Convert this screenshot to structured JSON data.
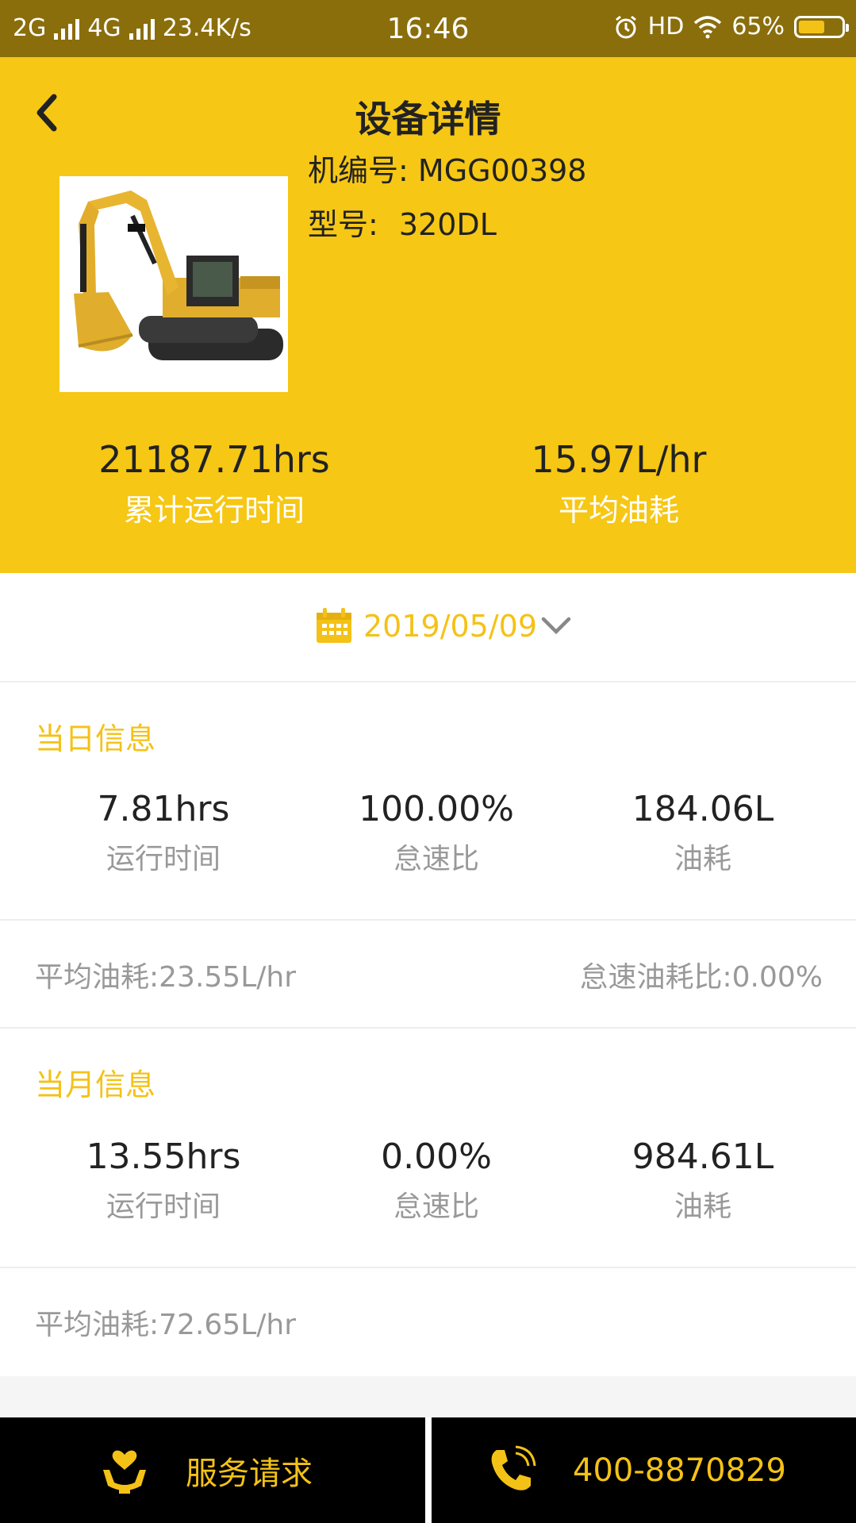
{
  "status_bar": {
    "network1": "2G",
    "network2": "4G",
    "speed": "23.4K/s",
    "time": "16:46",
    "hd": "HD",
    "battery": "65%",
    "battery_level": 0.65
  },
  "header": {
    "title": "设备详情",
    "machine_no_label": "机编号:",
    "machine_no": "MGG00398",
    "model_label": "型号:",
    "model": "320DL",
    "total_runtime_value": "21187.71hrs",
    "total_runtime_label": "累计运行时间",
    "avg_fuel_value": "15.97L/hr",
    "avg_fuel_label": "平均油耗"
  },
  "date_selector": {
    "date": "2019/05/09"
  },
  "daily": {
    "title": "当日信息",
    "runtime_value": "7.81hrs",
    "runtime_label": "运行时间",
    "idle_value": "100.00%",
    "idle_label": "怠速比",
    "fuel_value": "184.06L",
    "fuel_label": "油耗",
    "avg_fuel_label": "平均油耗:",
    "avg_fuel_value": "23.55L/hr",
    "idle_fuel_label": "怠速油耗比:",
    "idle_fuel_value": "0.00%"
  },
  "monthly": {
    "title": "当月信息",
    "runtime_value": "13.55hrs",
    "runtime_label": "运行时间",
    "idle_value": "0.00%",
    "idle_label": "怠速比",
    "fuel_value": "984.61L",
    "fuel_label": "油耗",
    "avg_fuel_label": "平均油耗:",
    "avg_fuel_value": "72.65L/hr"
  },
  "bottom_bar": {
    "service_label": "服务请求",
    "phone": "400-8870829"
  },
  "colors": {
    "accent": "#f6c714",
    "accent_text": "#f4c216",
    "status_bar": "#8a6e0c"
  },
  "icons": [
    "back-icon",
    "calendar-icon",
    "chevron-down-icon",
    "service-hands-icon",
    "phone-icon",
    "alarm-icon",
    "wifi-icon"
  ]
}
